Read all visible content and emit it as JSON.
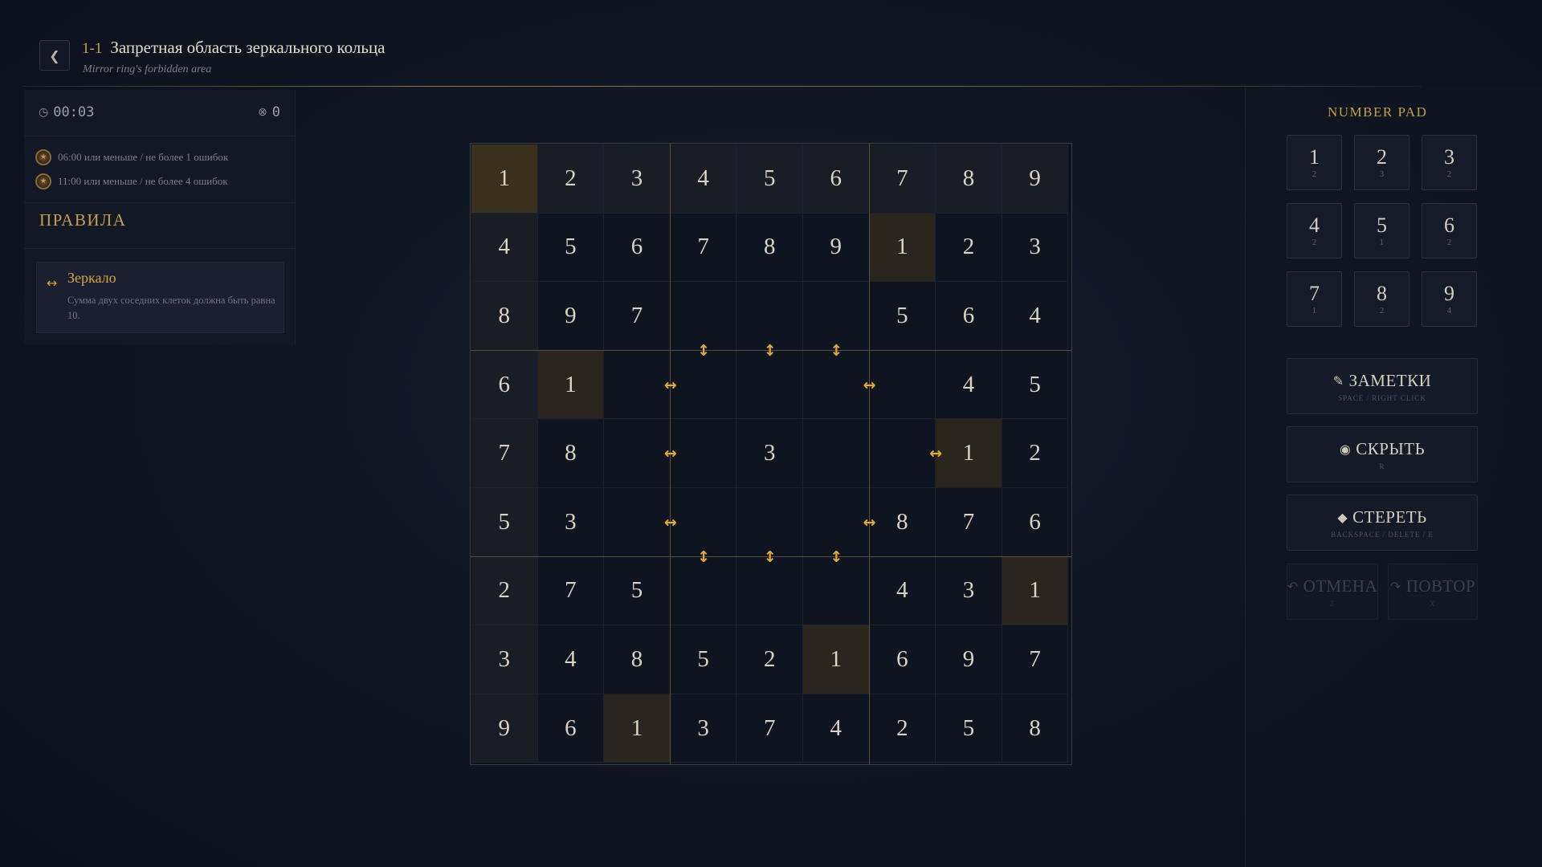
{
  "header": {
    "back_icon": "chevron-left-icon",
    "level_number": "1-1",
    "title": "Запретная область зеркального кольца",
    "subtitle": "Mirror ring's forbidden area"
  },
  "stats": {
    "timer": "00:03",
    "errors": "0",
    "goals": [
      {
        "text": "06:00 или меньше / не более 1 ошибок"
      },
      {
        "text": "11:00 или меньше / не более 4 ошибок"
      }
    ]
  },
  "rules": {
    "title": "ПРАВИЛА",
    "items": [
      {
        "icon": "↔",
        "name": "Зеркало",
        "description": "Сумма двух соседних клеток должна быть равна 10."
      }
    ]
  },
  "board": {
    "cells": [
      [
        "1",
        "2",
        "3",
        "4",
        "5",
        "6",
        "7",
        "8",
        "9"
      ],
      [
        "4",
        "5",
        "6",
        "7",
        "8",
        "9",
        "1",
        "2",
        "3"
      ],
      [
        "8",
        "9",
        "7",
        "",
        "",
        "",
        "5",
        "6",
        "4"
      ],
      [
        "6",
        "1",
        "",
        "",
        "",
        "",
        "",
        "4",
        "5"
      ],
      [
        "7",
        "8",
        "",
        "",
        "3",
        "",
        "",
        "1",
        "2"
      ],
      [
        "5",
        "3",
        "",
        "",
        "",
        "",
        "8",
        "7",
        "6"
      ],
      [
        "2",
        "7",
        "5",
        "",
        "",
        "",
        "4",
        "3",
        "1"
      ],
      [
        "3",
        "4",
        "8",
        "5",
        "2",
        "1",
        "6",
        "9",
        "7"
      ],
      [
        "9",
        "6",
        "1",
        "3",
        "7",
        "4",
        "2",
        "5",
        "8"
      ]
    ],
    "selected": [
      0,
      0
    ],
    "highlighted_ones": [
      [
        1,
        6
      ],
      [
        3,
        1
      ],
      [
        4,
        7
      ],
      [
        6,
        8
      ],
      [
        7,
        5
      ],
      [
        8,
        2
      ]
    ],
    "mirror_markers": [
      {
        "between": [
          [
            2,
            3
          ],
          [
            3,
            3
          ]
        ],
        "symbol": "↕"
      },
      {
        "between": [
          [
            2,
            4
          ],
          [
            3,
            4
          ]
        ],
        "symbol": "↕"
      },
      {
        "between": [
          [
            2,
            5
          ],
          [
            3,
            5
          ]
        ],
        "symbol": "↕"
      },
      {
        "between": [
          [
            3,
            2
          ],
          [
            3,
            3
          ]
        ],
        "symbol": "↔"
      },
      {
        "between": [
          [
            3,
            5
          ],
          [
            3,
            6
          ]
        ],
        "symbol": "↔"
      },
      {
        "between": [
          [
            4,
            2
          ],
          [
            4,
            3
          ]
        ],
        "symbol": "↔"
      },
      {
        "between": [
          [
            4,
            6
          ],
          [
            4,
            7
          ]
        ],
        "symbol": "↔"
      },
      {
        "between": [
          [
            5,
            2
          ],
          [
            5,
            3
          ]
        ],
        "symbol": "↔"
      },
      {
        "between": [
          [
            5,
            5
          ],
          [
            5,
            6
          ]
        ],
        "symbol": "↔"
      },
      {
        "between": [
          [
            5,
            3
          ],
          [
            6,
            3
          ]
        ],
        "symbol": "↕"
      },
      {
        "between": [
          [
            5,
            4
          ],
          [
            6,
            4
          ]
        ],
        "symbol": "↕"
      },
      {
        "between": [
          [
            5,
            5
          ],
          [
            6,
            5
          ]
        ],
        "symbol": "↕"
      }
    ]
  },
  "number_pad": {
    "title": "NUMBER PAD",
    "keys": [
      {
        "digit": "1",
        "count": "2"
      },
      {
        "digit": "2",
        "count": "3"
      },
      {
        "digit": "3",
        "count": "2"
      },
      {
        "digit": "4",
        "count": "2"
      },
      {
        "digit": "5",
        "count": "1"
      },
      {
        "digit": "6",
        "count": "2"
      },
      {
        "digit": "7",
        "count": "1"
      },
      {
        "digit": "8",
        "count": "2"
      },
      {
        "digit": "9",
        "count": "4"
      }
    ]
  },
  "actions": {
    "notes": {
      "label": "ЗАМЕТКИ",
      "hint": "SPACE / RIGHT CLICK",
      "icon": "pencil-icon"
    },
    "hide": {
      "label": "СКРЫТЬ",
      "hint": "R",
      "icon": "eye-icon"
    },
    "erase": {
      "label": "СТЕРЕТЬ",
      "hint": "BACKSPACE / DELETE / E",
      "icon": "eraser-icon"
    },
    "undo": {
      "label": "ОТМЕНА",
      "hint": "Z",
      "icon": "undo-icon"
    },
    "redo": {
      "label": "ПОВТОР",
      "hint": "X",
      "icon": "redo-icon"
    }
  },
  "colors": {
    "accent": "#c6a04a",
    "marker": "#e1a93f",
    "background": "#0f1522"
  }
}
